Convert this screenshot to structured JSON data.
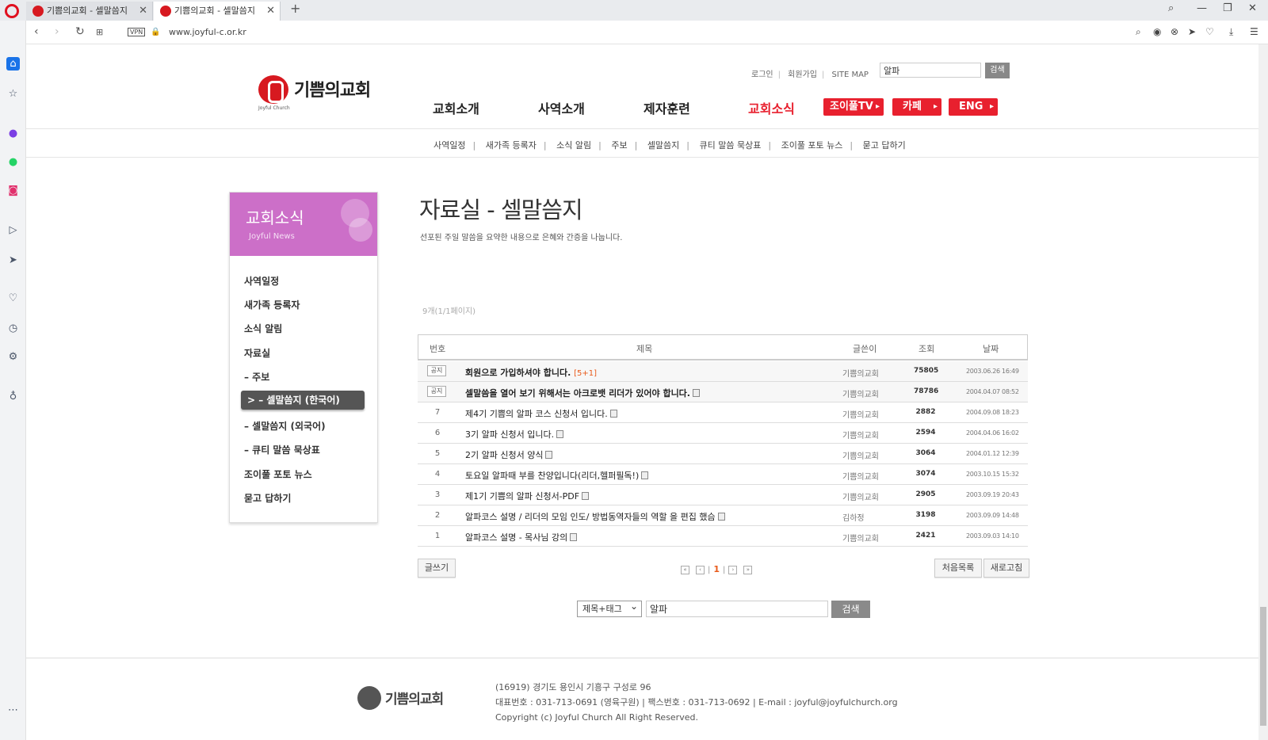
{
  "browser": {
    "tabs": [
      {
        "label": "기쁨의교회 - 셀말씀지"
      },
      {
        "label": "기쁨의교회 - 셀말씀지"
      }
    ],
    "url": "www.joyful-c.or.kr",
    "vpn_label": "VPN"
  },
  "header": {
    "logo_text": "기쁨의교회",
    "logo_sub": "Joyful Church",
    "toplinks": [
      "로그인",
      "회원가입",
      "SITE MAP"
    ],
    "search_value": "알파",
    "search_btn": "검색",
    "gnav": [
      "교회소개",
      "사역소개",
      "제자훈련",
      "교회소식"
    ],
    "red_buttons": [
      "조이풀TV",
      "카페",
      "ENG"
    ]
  },
  "subnav": [
    "사역일정",
    "새가족 등록자",
    "소식 알림",
    "주보",
    "셀말씀지",
    "큐티 말씀 묵상표",
    "조이풀 포토 뉴스",
    "묻고 답하기"
  ],
  "leftmenu": {
    "title": "교회소식",
    "subtitle": "Joyful News",
    "items": [
      "사역일정",
      "새가족 등록자",
      "소식 알림",
      "자료실",
      "– 주보",
      "> – 셀말씀지 (한국어)",
      "– 셀말씀지 (외국어)",
      "– 큐티 말씀 묵상표",
      "조이풀 포토 뉴스",
      "묻고 답하기"
    ]
  },
  "content": {
    "title": "자료실 - 셀말씀지",
    "desc": "선포된 주일 말씀을 요약한 내용으로 은혜와 간증을 나눕니다.",
    "count": "9개(1/1페이지)",
    "headers": [
      "번호",
      "제목",
      "글쓴이",
      "조회",
      "날짜"
    ],
    "rows": [
      {
        "no": "공지",
        "title": "회원으로 가입하셔야 합니다.",
        "comment": "[5+1]",
        "writer": "기쁨의교회",
        "views": "75805",
        "date": "2003.06.26 16:49"
      },
      {
        "no": "공지",
        "title": "셀말씀을 열어 보기 위해서는 아크로뱃 리더가 있어야 합니다.",
        "comment": "",
        "writer": "기쁨의교회",
        "views": "78786",
        "date": "2004.04.07 08:52"
      },
      {
        "no": "7",
        "title": "제4기 기쁨의 알파 코스 신청서 입니다.",
        "comment": "",
        "writer": "기쁨의교회",
        "views": "2882",
        "date": "2004.09.08 18:23"
      },
      {
        "no": "6",
        "title": "3기 알파 신청서 입니다.",
        "comment": "",
        "writer": "기쁨의교회",
        "views": "2594",
        "date": "2004.04.06 16:02"
      },
      {
        "no": "5",
        "title": "2기 알파 신청서 양식",
        "comment": "",
        "writer": "기쁨의교회",
        "views": "3064",
        "date": "2004.01.12 12:39"
      },
      {
        "no": "4",
        "title": "토요일 알파때 부를 찬양입니다(리더,헬퍼필독!)",
        "comment": "",
        "writer": "기쁨의교회",
        "views": "3074",
        "date": "2003.10.15 15:32"
      },
      {
        "no": "3",
        "title": "제1기 기쁨의 알파 신청서-PDF",
        "comment": "",
        "writer": "기쁨의교회",
        "views": "2905",
        "date": "2003.09.19 20:43"
      },
      {
        "no": "2",
        "title": "알파코스 설명 / 리더의 모임 인도/ 방법동역자들의 역할 을 편집 했슴",
        "comment": "",
        "writer": "김하정",
        "views": "3198",
        "date": "2003.09.09 14:48"
      },
      {
        "no": "1",
        "title": "알파코스 설명 - 목사님 강의",
        "comment": "",
        "writer": "기쁨의교회",
        "views": "2421",
        "date": "2003.09.03 14:10"
      }
    ],
    "write_btn": "글쓰기",
    "page_current": "1",
    "list_btn": "처음목록",
    "refresh_btn": "새로고침",
    "search_select": "제목+태그",
    "search_value": "알파",
    "search_btn": "검색"
  },
  "footer": {
    "logo_text": "기쁨의교회",
    "address": "(16919) 경기도 용인시 기흥구 구성로 96",
    "contact": "대표번호 : 031-713-0691 (영육구원) | 팩스번호 : 031-713-0692 | E-mail : joyful@joyfulchurch.org",
    "copyright": "Copyright (c) Joyful Church All Right Reserved."
  }
}
